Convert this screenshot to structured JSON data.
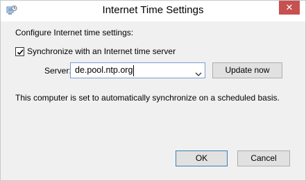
{
  "window": {
    "title": "Internet Time Settings",
    "close_label": "✕"
  },
  "dialog": {
    "heading": "Configure Internet time settings:",
    "sync_checkbox": {
      "label": "Synchronize with an Internet time server",
      "checked": true
    },
    "server": {
      "label": "Server:",
      "value": "de.pool.ntp.org"
    },
    "update_button": "Update now",
    "status_message": "This computer is set to automatically synchronize on a scheduled basis.",
    "ok_button": "OK",
    "cancel_button": "Cancel"
  },
  "colors": {
    "window_bg": "#f0f0f0",
    "close_button": "#c75050",
    "focus_border": "#7a9cd3"
  },
  "icons": {
    "title": "clock-settings-icon",
    "combo_arrow": "chevron-down-icon",
    "check": "checkmark-icon"
  }
}
